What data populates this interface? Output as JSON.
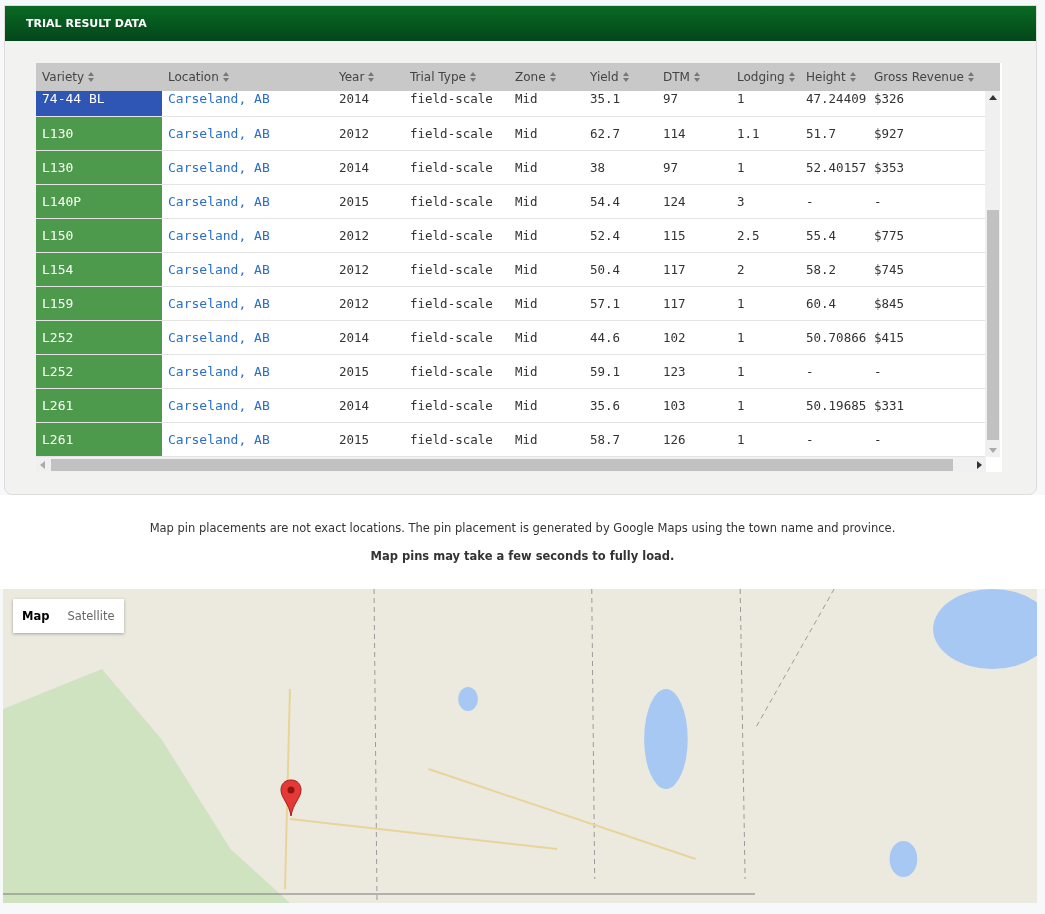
{
  "panel": {
    "title": "TRIAL RESULT DATA"
  },
  "table": {
    "columns": [
      "Variety",
      "Location",
      "Year",
      "Trial Type",
      "Zone",
      "Yield",
      "DTM",
      "Lodging",
      "Height",
      "Gross Revenue"
    ],
    "rows": [
      {
        "color": "#2f56b4",
        "cells": [
          "74-44 BL",
          "Carseland, AB",
          "2014",
          "field-scale",
          "Mid",
          "35.1",
          "97",
          "1",
          "47.24409",
          "$326"
        ]
      },
      {
        "color": "#4e9a4c",
        "cells": [
          "L130",
          "Carseland, AB",
          "2012",
          "field-scale",
          "Mid",
          "62.7",
          "114",
          "1.1",
          "51.7",
          "$927"
        ]
      },
      {
        "color": "#4e9a4c",
        "cells": [
          "L130",
          "Carseland, AB",
          "2014",
          "field-scale",
          "Mid",
          "38",
          "97",
          "1",
          "52.40157",
          "$353"
        ]
      },
      {
        "color": "#4e9a4c",
        "cells": [
          "L140P",
          "Carseland, AB",
          "2015",
          "field-scale",
          "Mid",
          "54.4",
          "124",
          "3",
          "-",
          "-"
        ]
      },
      {
        "color": "#4e9a4c",
        "cells": [
          "L150",
          "Carseland, AB",
          "2012",
          "field-scale",
          "Mid",
          "52.4",
          "115",
          "2.5",
          "55.4",
          "$775"
        ]
      },
      {
        "color": "#4e9a4c",
        "cells": [
          "L154",
          "Carseland, AB",
          "2012",
          "field-scale",
          "Mid",
          "50.4",
          "117",
          "2",
          "58.2",
          "$745"
        ]
      },
      {
        "color": "#4e9a4c",
        "cells": [
          "L159",
          "Carseland, AB",
          "2012",
          "field-scale",
          "Mid",
          "57.1",
          "117",
          "1",
          "60.4",
          "$845"
        ]
      },
      {
        "color": "#4e9a4c",
        "cells": [
          "L252",
          "Carseland, AB",
          "2014",
          "field-scale",
          "Mid",
          "44.6",
          "102",
          "1",
          "50.70866",
          "$415"
        ]
      },
      {
        "color": "#4e9a4c",
        "cells": [
          "L252",
          "Carseland, AB",
          "2015",
          "field-scale",
          "Mid",
          "59.1",
          "123",
          "1",
          "-",
          "-"
        ]
      },
      {
        "color": "#4e9a4c",
        "cells": [
          "L261",
          "Carseland, AB",
          "2014",
          "field-scale",
          "Mid",
          "35.6",
          "103",
          "1",
          "50.19685",
          "$331"
        ]
      },
      {
        "color": "#4e9a4c",
        "cells": [
          "L261",
          "Carseland, AB",
          "2015",
          "field-scale",
          "Mid",
          "58.7",
          "126",
          "1",
          "-",
          "-"
        ]
      }
    ]
  },
  "notes": [
    {
      "text": "Map pin placements are not exact locations. The pin placement is generated by Google Maps using the town name and province.",
      "bold": false
    },
    {
      "text": "Map pins may take a few seconds to fully load.",
      "bold": true
    }
  ],
  "map": {
    "types": [
      {
        "label": "Map",
        "selected": true
      },
      {
        "label": "Satellite",
        "selected": false
      }
    ]
  }
}
